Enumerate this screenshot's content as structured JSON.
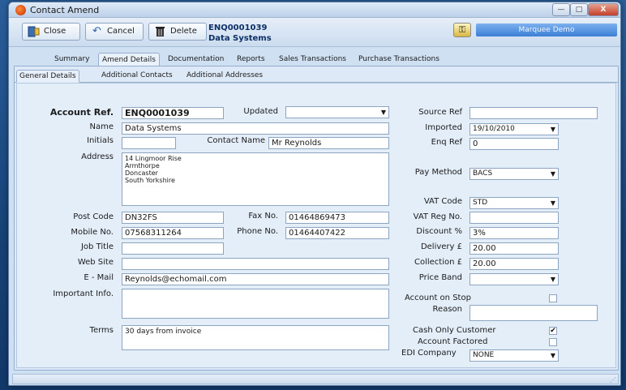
{
  "window": {
    "title": "Contact Amend",
    "min_glyph": "—",
    "max_glyph": "□",
    "close_glyph": "X"
  },
  "toolbar": {
    "close_label": "Close",
    "cancel_label": "Cancel",
    "delete_label": "Delete",
    "record_ref": "ENQ0001039",
    "record_name": "Data Systems",
    "company": "Marquee Demo"
  },
  "main_tabs": [
    "Summary",
    "Amend Details",
    "Documentation",
    "Reports",
    "Sales Transactions",
    "Purchase Transactions"
  ],
  "sub_tabs": [
    "General Details",
    "Additional Contacts",
    "Additional Addresses"
  ],
  "form": {
    "account_ref_label": "Account Ref.",
    "account_ref": "ENQ0001039",
    "updated_label": "Updated",
    "updated": "",
    "name_label": "Name",
    "name": "Data Systems",
    "initials_label": "Initials",
    "initials": "",
    "contact_name_label": "Contact Name",
    "contact_name": "Mr  Reynolds",
    "address_label": "Address",
    "address": "14 Lingmoor Rise\nArmthorpe\nDoncaster\nSouth Yorkshire",
    "post_code_label": "Post Code",
    "post_code": "DN32FS",
    "fax_label": "Fax No.",
    "fax": "01464869473",
    "mobile_label": "Mobile No.",
    "mobile": "07568311264",
    "phone_label": "Phone No.",
    "phone": "01464407422",
    "job_title_label": "Job Title",
    "job_title": "",
    "web_site_label": "Web Site",
    "web_site": "",
    "email_label": "E - Mail",
    "email": "Reynolds@echomail.com",
    "important_label": "Important Info.",
    "important": "",
    "terms_label": "Terms",
    "terms": "30 days from invoice",
    "source_ref_label": "Source Ref",
    "source_ref": "",
    "imported_label": "Imported",
    "imported": "19/10/2010",
    "enq_ref_label": "Enq Ref",
    "enq_ref": "0",
    "pay_method_label": "Pay Method",
    "pay_method": "BACS",
    "vat_code_label": "VAT Code",
    "vat_code": "STD",
    "vat_reg_label": "VAT Reg No.",
    "vat_reg": "",
    "discount_label": "Discount %",
    "discount": "3%",
    "delivery_label": "Delivery £",
    "delivery": "20.00",
    "collection_label": "Collection £",
    "collection": "20.00",
    "price_band_label": "Price Band",
    "price_band": "",
    "account_stop_label": "Account on Stop",
    "account_stop": false,
    "reason_label": "Reason",
    "reason": "",
    "cash_only_label": "Cash Only Customer",
    "cash_only": true,
    "account_factored_label": "Account Factored",
    "account_factored": false,
    "edi_label": "EDI Company",
    "edi": "NONE",
    "check_mark": "✔"
  }
}
